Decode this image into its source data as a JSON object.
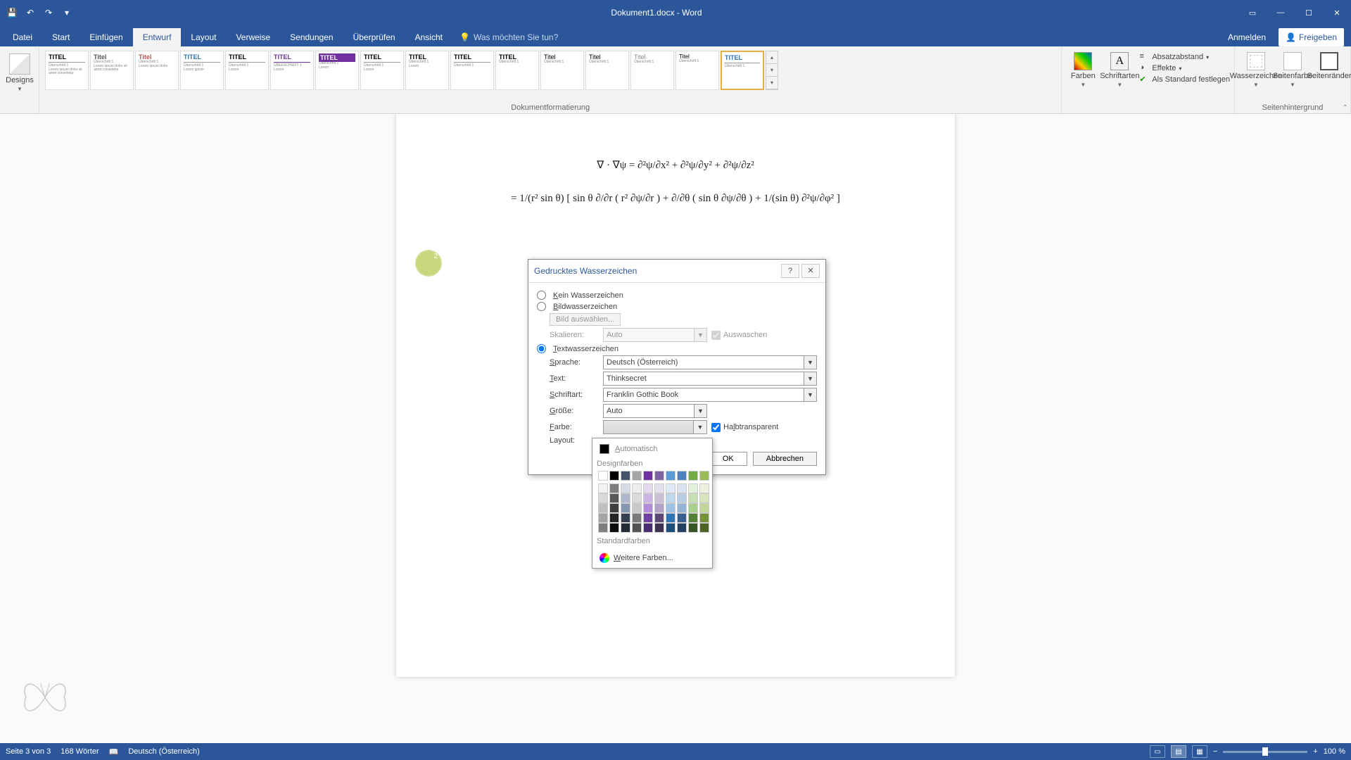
{
  "titlebar": {
    "title": "Dokument1.docx - Word"
  },
  "tabs": {
    "items": [
      "Datei",
      "Start",
      "Einfügen",
      "Entwurf",
      "Layout",
      "Verweise",
      "Sendungen",
      "Überprüfen",
      "Ansicht"
    ],
    "active_index": 3,
    "tellme": "Was möchten Sie tun?",
    "account": "Anmelden",
    "share": "Freigeben"
  },
  "ribbon": {
    "themes_label": "Designs",
    "gallery_titles": [
      "TITEL",
      "Titel",
      "Titel",
      "TITEL",
      "TITEL",
      "TITEL",
      "TITEL",
      "TITEL",
      "TITEL",
      "TITEL",
      "TITEL",
      "Titel",
      "Titel",
      "Titel",
      "Titel",
      "TITEL"
    ],
    "doc_format_group": "Dokumentformatierung",
    "colors": "Farben",
    "fonts": "Schriftarten",
    "spacing": "Absatzabstand",
    "effects": "Effekte",
    "set_default": "Als Standard festlegen",
    "watermark": "Wasserzeichen",
    "page_color": "Seitenfarbe",
    "page_borders": "Seitenränder",
    "page_bg_group": "Seitenhintergrund"
  },
  "document": {
    "eq1": "∇ · ∇ψ = ∂²ψ/∂x² + ∂²ψ/∂y² + ∂²ψ/∂z²",
    "eq2": "= 1/(r² sin θ) [ sin θ ∂/∂r ( r² ∂ψ/∂r ) + ∂/∂θ ( sin θ ∂ψ/∂θ ) + 1/(sin θ) ∂²ψ/∂φ² ]"
  },
  "dialog": {
    "title": "Gedrucktes Wasserzeichen",
    "opt_none": "Kein Wasserzeichen",
    "opt_picture": "Bildwasserzeichen",
    "select_picture": "Bild auswählen...",
    "scale_label": "Skalieren:",
    "scale_value": "Auto",
    "washout": "Auswaschen",
    "opt_text": "Textwasserzeichen",
    "language_label": "Sprache:",
    "language_value": "Deutsch (Österreich)",
    "text_label": "Text:",
    "text_value": "Thinksecret",
    "font_label": "Schriftart:",
    "font_value": "Franklin Gothic Book",
    "size_label": "Größe:",
    "size_value": "Auto",
    "color_label": "Farbe:",
    "semitransparent": "Halbtransparent",
    "layout_label": "Layout:",
    "ok": "OK",
    "cancel": "Abbrechen"
  },
  "colorpicker": {
    "automatic": "Automatisch",
    "theme_section": "Designfarben",
    "theme_colors_row1": [
      "#ffffff",
      "#000000",
      "#44546a",
      "#a5a5a5",
      "#7030a0",
      "#8064a2",
      "#5b9bd5",
      "#4f81bd",
      "#70ad47",
      "#9bbb59"
    ],
    "theme_shades": [
      [
        "#f2f2f2",
        "#7f7f7f",
        "#d6dce4",
        "#ededed",
        "#e5d9f2",
        "#e4dfec",
        "#deebf6",
        "#dbe5f1",
        "#e2efd9",
        "#ebf1de"
      ],
      [
        "#d8d8d8",
        "#595959",
        "#adb9ca",
        "#dbdbdb",
        "#ccb3e6",
        "#ccc0d9",
        "#bdd7ee",
        "#b8cce4",
        "#c5e0b3",
        "#d7e4bc"
      ],
      [
        "#bfbfbf",
        "#3f3f3f",
        "#8496b0",
        "#c9c9c9",
        "#b28cd9",
        "#b2a1c7",
        "#9cc3e5",
        "#95b3d7",
        "#a8d08d",
        "#c2d69b"
      ],
      [
        "#a5a5a5",
        "#262626",
        "#323f4f",
        "#7b7b7b",
        "#6b3fa0",
        "#5f497a",
        "#2e75b5",
        "#366092",
        "#538135",
        "#76923c"
      ],
      [
        "#7f7f7f",
        "#0c0c0c",
        "#222a35",
        "#525252",
        "#4a2c70",
        "#3f3151",
        "#1e4e79",
        "#244061",
        "#375623",
        "#4f6228"
      ]
    ],
    "standard_section": "Standardfarben",
    "standard_colors": [
      "#c00000",
      "#ff0000",
      "#ffc000",
      "#ffff00",
      "#92d050",
      "#00b050",
      "#00b0f0",
      "#0070c0",
      "#002060",
      "#7030a0"
    ],
    "more_colors": "Weitere Farben..."
  },
  "statusbar": {
    "page": "Seite 3 von 3",
    "words": "168 Wörter",
    "language": "Deutsch (Österreich)",
    "zoom": "100 %"
  },
  "cursor_badge": "2"
}
